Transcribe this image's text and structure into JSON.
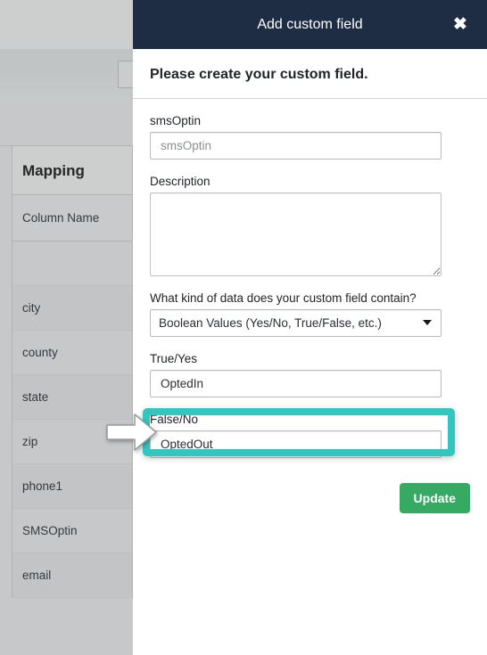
{
  "background": {
    "table": {
      "title": "Mapping",
      "column_header": "Column Name",
      "rows": [
        "",
        "city",
        "county",
        "state",
        "zip",
        "phone1",
        "SMSOptin",
        "email"
      ]
    }
  },
  "modal": {
    "title": "Add custom field",
    "close_icon": "close-icon",
    "close_glyph": "✖",
    "subtitle": "Please create your custom field.",
    "fields": {
      "name": {
        "label": "smsOptin",
        "value": "",
        "placeholder": "smsOptin"
      },
      "description": {
        "label": "Description",
        "value": "",
        "placeholder": ""
      },
      "data_kind": {
        "label": "What kind of data does your custom field contain?",
        "selected": "Boolean Values (Yes/No, True/False, etc.)",
        "caret_icon": "chevron-down-icon"
      },
      "true_yes": {
        "label": "True/Yes",
        "value": "OptedIn",
        "placeholder": ""
      },
      "false_no": {
        "label": "False/No",
        "value": "OptedOut",
        "placeholder": ""
      }
    },
    "footer": {
      "update_label": "Update"
    }
  },
  "annotation": {
    "highlight_color": "#33c5c0",
    "arrow_icon": "arrow-right-icon",
    "arrow_fill": "#ffffff",
    "arrow_stroke": "#9a9c9e"
  },
  "colors": {
    "header_bg": "#1e2c44",
    "update_button": "#36a963",
    "highlight": "#33c5c0",
    "page_dim": "#c6c8c9"
  }
}
